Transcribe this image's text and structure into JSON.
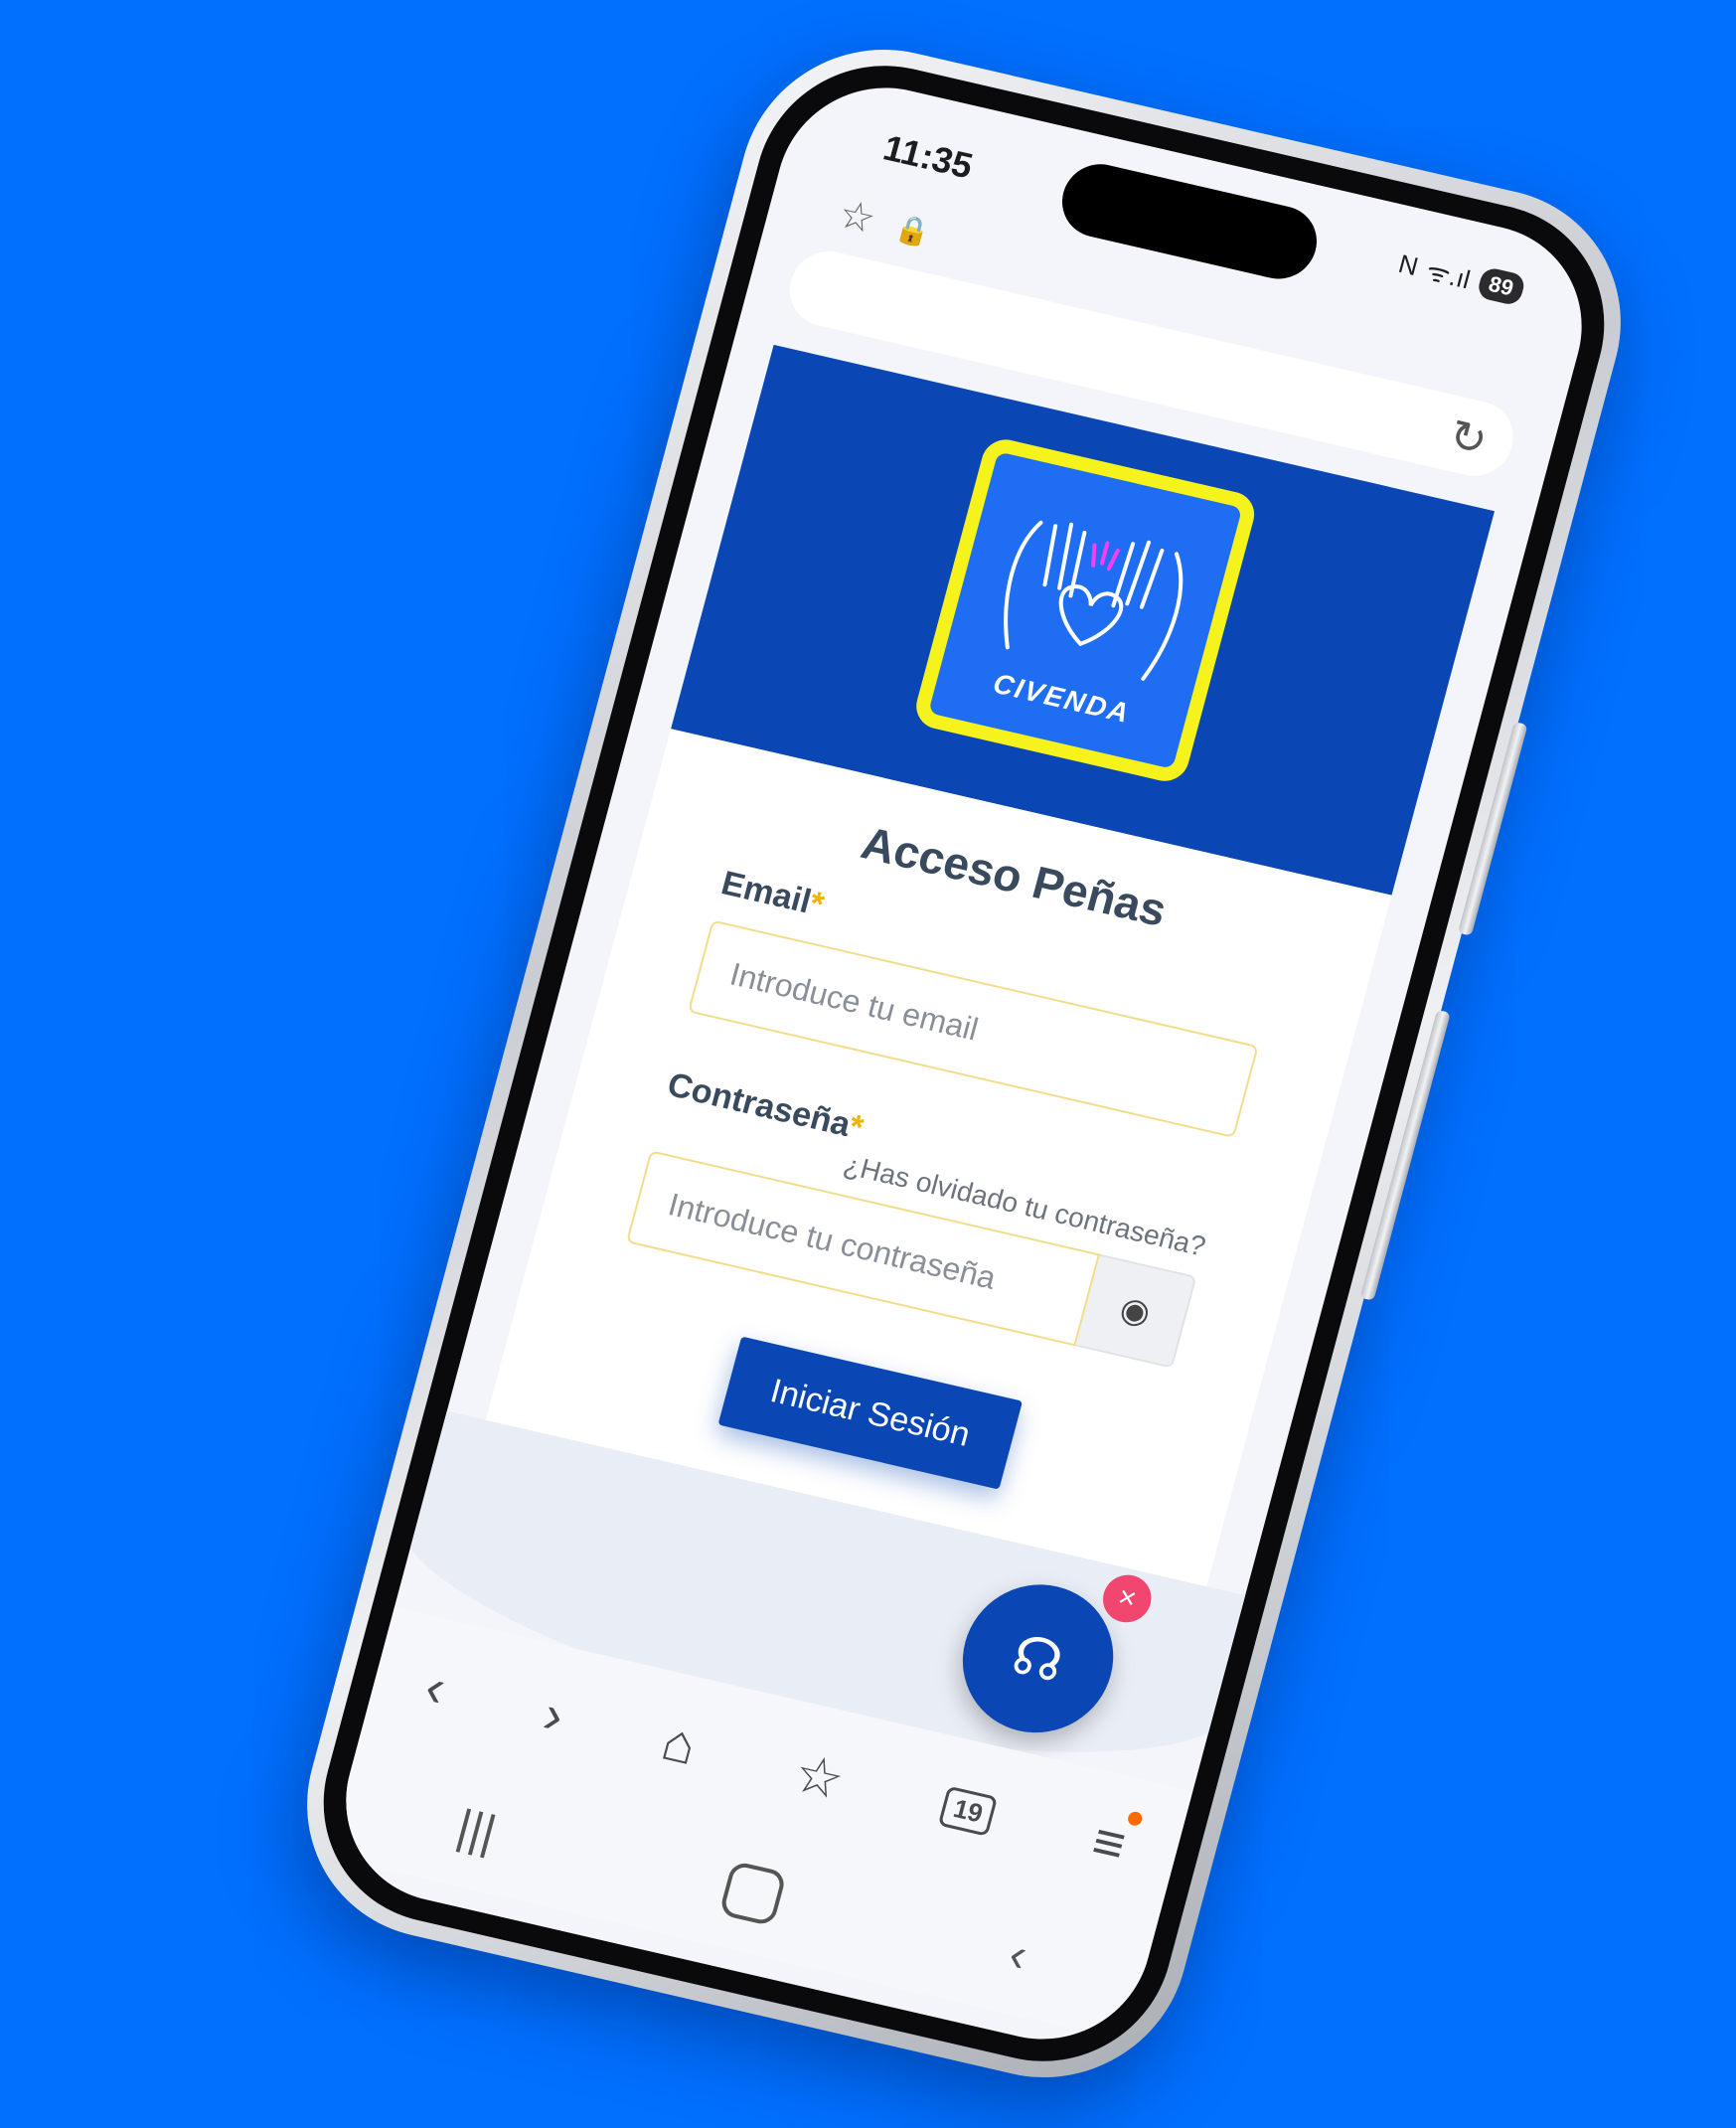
{
  "status_bar": {
    "time": "11:35",
    "battery": "89",
    "nfc_label": "N",
    "signal": "ᯤ.ıl"
  },
  "browser": {
    "bookmark_icon": "☆",
    "lock_icon": "🔒",
    "reload_icon": "↻"
  },
  "logo": {
    "text": "CIVENDA",
    "colors": {
      "frame": "#f5f21c",
      "fill": "#1f6df2"
    }
  },
  "login": {
    "title": "Acceso Peñas",
    "email_label": "Email",
    "email_required": "*",
    "email_placeholder": "Introduce tu email",
    "password_label": "Contraseña",
    "password_required": "*",
    "forgot_link": "¿Has olvidado tu contraseña?",
    "password_placeholder": "Introduce tu contraseña",
    "eye_icon": "◉",
    "submit": "Iniciar Sesión"
  },
  "chat": {
    "fab_icon": "☊",
    "close_icon": "×"
  },
  "toolbar": {
    "back": "‹",
    "forward": "›",
    "home": "⌂",
    "bookmarks": "☆",
    "tabs_date": "19",
    "menu": "≡"
  },
  "system_nav": {
    "recents": "|||",
    "back": "‹"
  },
  "colors": {
    "background": "#0070ff",
    "primary": "#0a47b5",
    "required": "#f0b400",
    "badge": "#f0466f"
  }
}
